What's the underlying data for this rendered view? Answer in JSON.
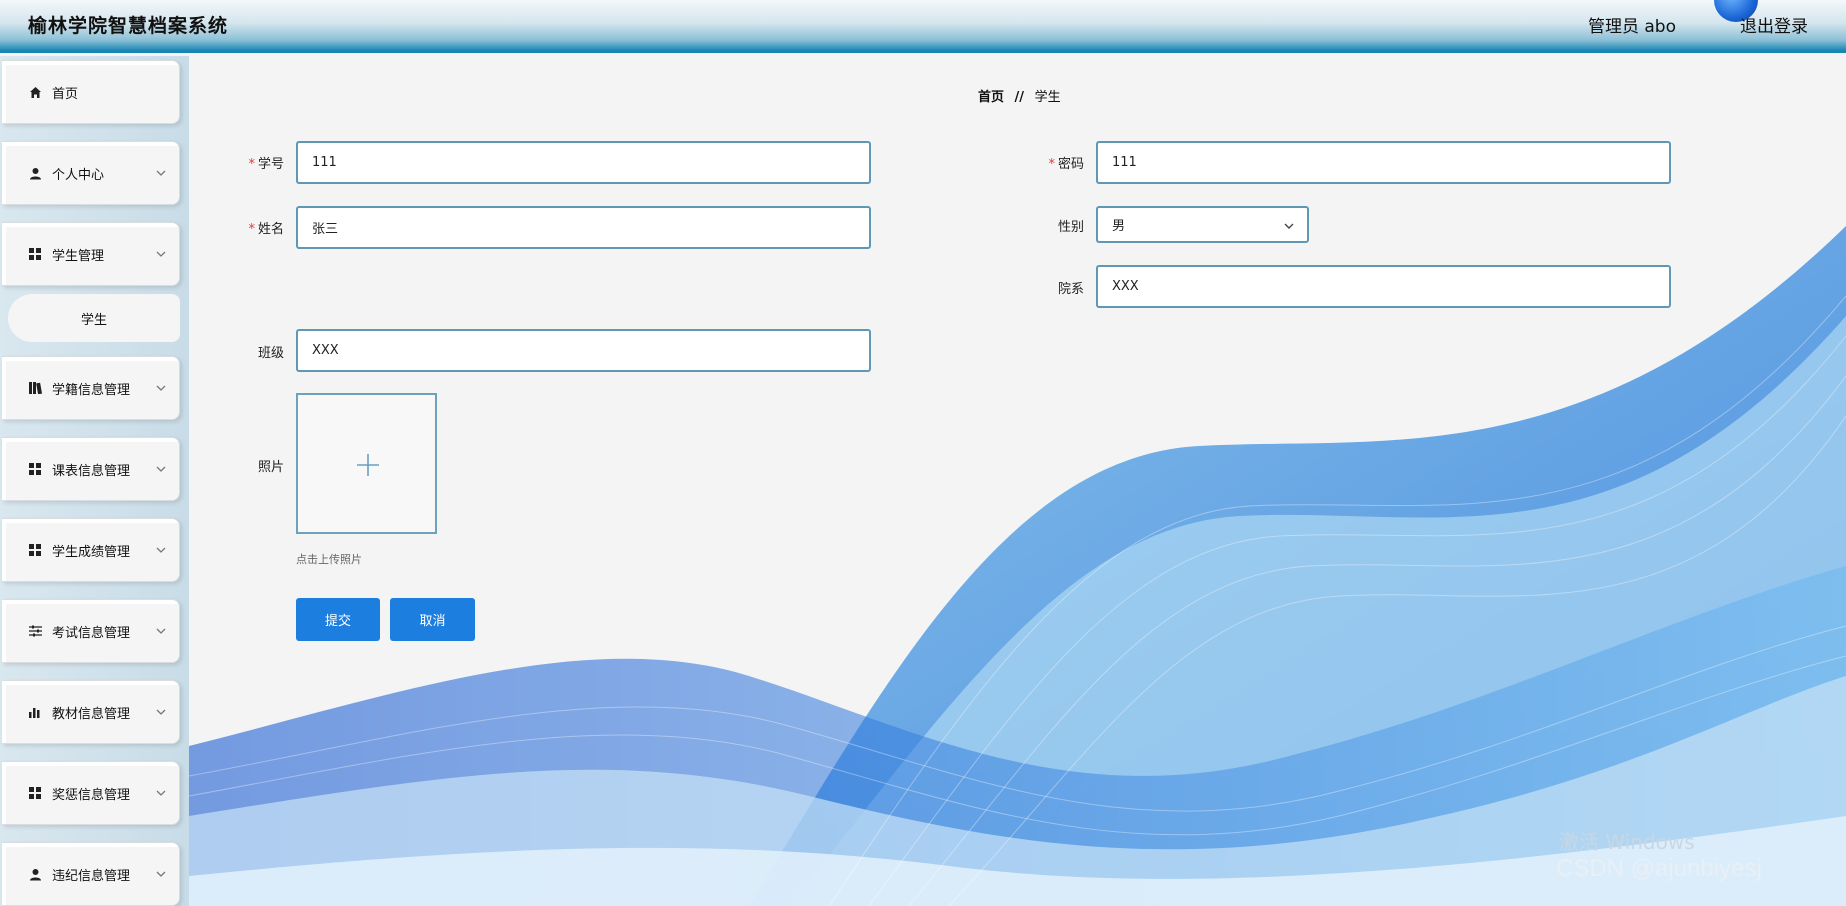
{
  "header": {
    "title": "榆林学院智慧档案系统",
    "user": "管理员 abo",
    "logout": "退出登录"
  },
  "sidebar": {
    "items": [
      {
        "label": "首页",
        "icon": "home-icon"
      },
      {
        "label": "个人中心",
        "icon": "user-icon"
      },
      {
        "label": "学生管理",
        "icon": "grid-icon"
      },
      {
        "label": "学籍信息管理",
        "icon": "book-icon"
      },
      {
        "label": "课表信息管理",
        "icon": "grid-icon"
      },
      {
        "label": "学生成绩管理",
        "icon": "grid-icon"
      },
      {
        "label": "考试信息管理",
        "icon": "sliders-icon"
      },
      {
        "label": "教材信息管理",
        "icon": "bar-chart-icon"
      },
      {
        "label": "奖惩信息管理",
        "icon": "grid-icon"
      },
      {
        "label": "违纪信息管理",
        "icon": "user-icon"
      }
    ],
    "sub_item": "学生"
  },
  "breadcrumb": {
    "home": "首页",
    "sep": "//",
    "current": "学生"
  },
  "form": {
    "student_id": {
      "label": "学号",
      "value": "111"
    },
    "password": {
      "label": "密码",
      "value": "111"
    },
    "name": {
      "label": "姓名",
      "value": "张三"
    },
    "gender": {
      "label": "性别",
      "value": "男"
    },
    "department": {
      "label": "院系",
      "value": "XXX"
    },
    "class": {
      "label": "班级",
      "value": "XXX"
    },
    "photo": {
      "label": "照片",
      "hint": "点击上传照片"
    },
    "required_mark": "*"
  },
  "buttons": {
    "submit": "提交",
    "cancel": "取消"
  },
  "watermarks": {
    "windows": "激活 Windows",
    "csdn": "CSDN @ajunbiyesj"
  },
  "colors": {
    "primary": "#1c7fe0",
    "header_accent": "#1b86b4",
    "input_border": "#5e98b4"
  }
}
